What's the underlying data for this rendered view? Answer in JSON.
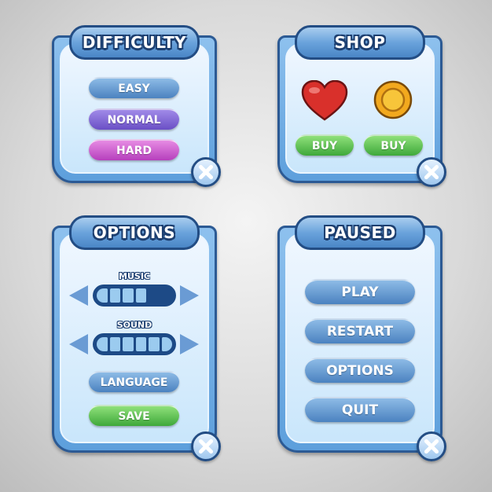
{
  "difficulty": {
    "title": "DIFFICULTY",
    "buttons": [
      {
        "label": "EASY"
      },
      {
        "label": "NORMAL"
      },
      {
        "label": "HARD"
      }
    ]
  },
  "shop": {
    "title": "SHOP",
    "items": [
      {
        "icon": "heart-icon",
        "buy_label": "BUY"
      },
      {
        "icon": "coin-icon",
        "buy_label": "BUY"
      }
    ]
  },
  "options": {
    "title": "OPTIONS",
    "music": {
      "label": "MUSIC",
      "level": 4,
      "max": 6
    },
    "sound": {
      "label": "SOUND",
      "level": 6,
      "max": 6
    },
    "language_label": "LANGUAGE",
    "save_label": "SAVE"
  },
  "paused": {
    "title": "PAUSED",
    "buttons": [
      {
        "label": "PLAY"
      },
      {
        "label": "RESTART"
      },
      {
        "label": "OPTIONS"
      },
      {
        "label": "QUIT"
      }
    ]
  },
  "colors": {
    "panel_border": "#2c5a94",
    "button_blue": "#4b82c0",
    "button_purple": "#6a4fc5",
    "button_pink": "#b63fbd",
    "button_green": "#3ea83a"
  }
}
